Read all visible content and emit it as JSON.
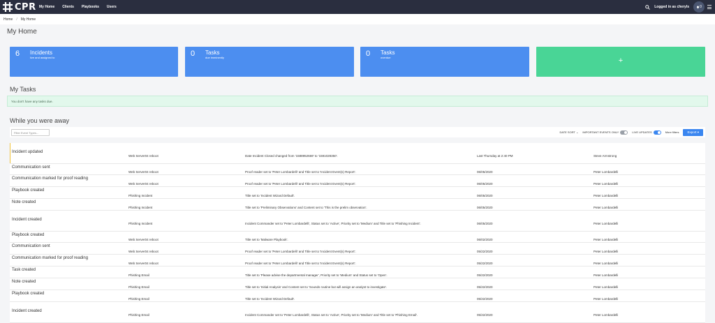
{
  "nav": {
    "brand": "CPR",
    "items": [
      "My Home",
      "Clients",
      "Playbooks",
      "Users"
    ],
    "logged_in": "Logged in as cheryls",
    "notif_count": "0"
  },
  "breadcrumb": [
    "Home",
    "My Home"
  ],
  "page_title": "My Home",
  "cards": [
    {
      "count": "6",
      "title": "Incidents",
      "subtitle": "live and assigned to"
    },
    {
      "count": "0",
      "title": "Tasks",
      "subtitle": "due imminently"
    },
    {
      "count": "0",
      "title": "Tasks",
      "subtitle": "overdue"
    }
  ],
  "add_card": {
    "label": "+"
  },
  "tasks": {
    "title": "My Tasks",
    "empty": "You don't have any tasks due."
  },
  "away": {
    "title": "While you were away",
    "filter_placeholder": "Filter Event Types...",
    "date_sort": "DATE SORT ⌄",
    "important_only": "IMPORTANT EVENTS ONLY",
    "live_updates": "LIVE UPDATES",
    "more_filters": "More filters",
    "export": "Export ▾"
  },
  "events": [
    {
      "type": "Incident updated",
      "incident": "Web Server04 reboot",
      "desc": "Date Incident Closed changed from '1588952669' to '1591028350'.",
      "date": "Last Thursday at 2:40 PM",
      "user": "Steve Armstrong"
    },
    {
      "type": "Communication sent",
      "incident": "Web Server04 reboot",
      "desc": "Proof reader set to 'Peter Lombardelli' and Title set to 'Incident Event(s) Report'.",
      "date": "06/05/2020",
      "user": "Peter Lombardelli"
    },
    {
      "type": "Communication marked for proof reading",
      "incident": "Web Server04 reboot",
      "desc": "Proof reader set to 'Peter Lombardelli' and Title set to 'Incident Event(s) Report'.",
      "date": "06/05/2020",
      "user": "Peter Lombardelli"
    },
    {
      "type": "Playbook created",
      "incident": "Phishing Incident",
      "desc": "Title set to 'Incident Wizard Default'.",
      "date": "06/05/2020",
      "user": "Peter Lombardelli"
    },
    {
      "type": "Note created",
      "incident": "Phishing Incident",
      "desc": "Title set to 'Preliminary Observations' and Content set to 'This is the prelim observation'.",
      "date": "06/05/2020",
      "user": "Peter Lombardelli"
    },
    {
      "type": "Incident created",
      "incident": "Phishing Incident",
      "desc": "Incident Commander set to 'Peter Lombardelli', Status set to 'Active', Priority set to 'Medium' and Title set to 'Phishing Incident'.",
      "date": "06/05/2020",
      "user": "Peter Lombardelli"
    },
    {
      "type": "Playbook created",
      "incident": "Web Server04 reboot",
      "desc": "Title set to 'Malware Playbook'.",
      "date": "06/02/2020",
      "user": "Peter Lombardelli"
    },
    {
      "type": "Communication sent",
      "incident": "Web Server04 reboot",
      "desc": "Proof reader set to 'Peter Lombardelli' and Title set to 'Incident Event(s) Report'.",
      "date": "05/22/2020",
      "user": "Peter Lombardelli"
    },
    {
      "type": "Communication marked for proof reading",
      "incident": "Web Server04 reboot",
      "desc": "Proof reader set to 'Peter Lombardelli' and Title set to 'Incident Event(s) Report'.",
      "date": "05/22/2020",
      "user": "Peter Lombardelli"
    },
    {
      "type": "Task created",
      "incident": "Phishing Email",
      "desc": "Title set to 'Please advise the departmental manager', Priority set to 'Medium' and Status set to 'Open'.",
      "date": "05/22/2020",
      "user": "Peter Lombardelli"
    },
    {
      "type": "Note created",
      "incident": "Phishing Email",
      "desc": "Title set to 'Initial Analysis' and Content set to 'Sounds routine but will assign an analyst to investigate'.",
      "date": "05/22/2020",
      "user": "Peter Lombardelli"
    },
    {
      "type": "Playbook created",
      "incident": "Phishing Email",
      "desc": "Title set to 'Incident Wizard Default'.",
      "date": "05/22/2020",
      "user": "Peter Lombardelli"
    },
    {
      "type": "Incident created",
      "incident": "Phishing Email",
      "desc": "Incident Commander set to 'Peter Lombardelli', Status set to 'Active', Priority set to 'Medium' and Title set to 'Phishing Email'.",
      "date": "05/22/2020",
      "user": "Peter Lombardelli"
    }
  ]
}
